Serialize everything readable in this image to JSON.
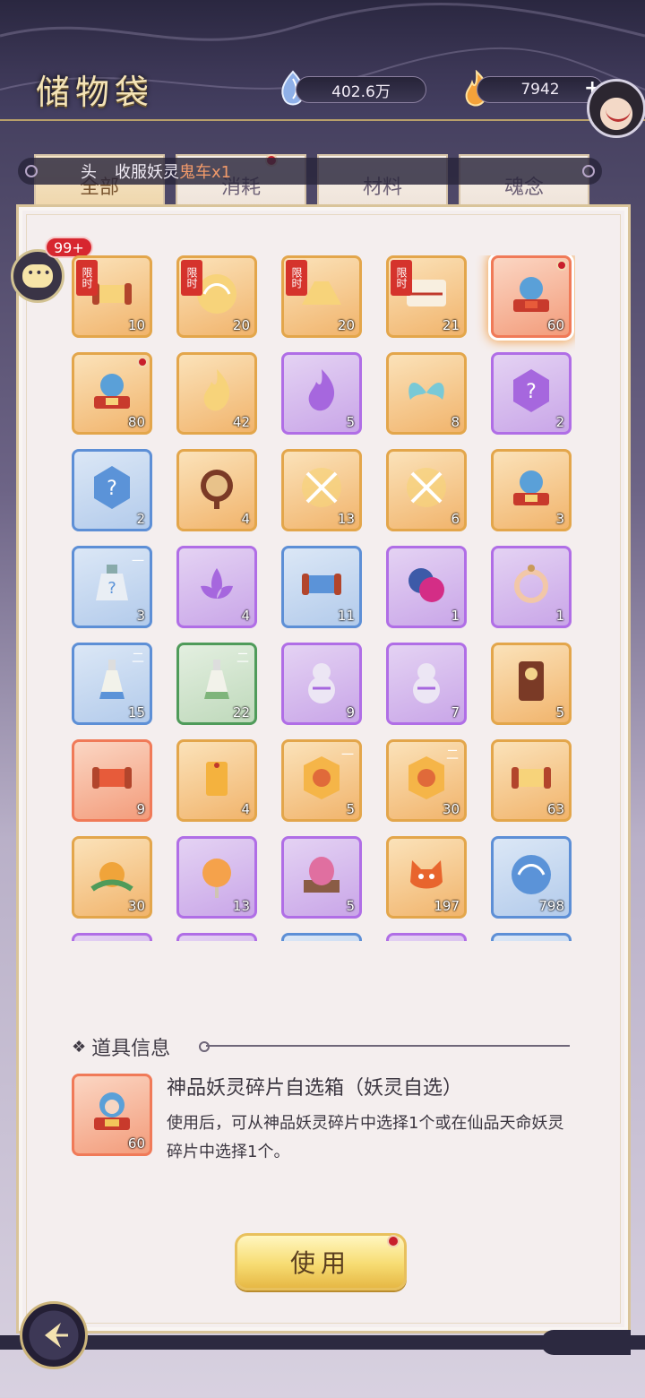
{
  "header": {
    "title": "储物袋",
    "currency_1": {
      "value": "402.6万",
      "icon": "spirit-gem-icon"
    },
    "currency_2": {
      "value": "7942",
      "icon": "flame-icon",
      "add": "+"
    }
  },
  "notice": {
    "prefix": "头",
    "text": "收服妖灵",
    "highlight": "鬼车x1"
  },
  "tabs": [
    {
      "label": "全部",
      "active": true
    },
    {
      "label": "消耗",
      "active": false
    },
    {
      "label": "材料",
      "active": false
    },
    {
      "label": "魂念",
      "active": false
    }
  ],
  "chat": {
    "badge": "99+"
  },
  "items": [
    {
      "count": "10",
      "rarity": "orange",
      "limit": "限时",
      "art": "scroll"
    },
    {
      "count": "20",
      "rarity": "orange",
      "limit": "限时",
      "art": "orb"
    },
    {
      "count": "20",
      "rarity": "orange",
      "limit": "限时",
      "art": "ingot"
    },
    {
      "count": "21",
      "rarity": "orange",
      "limit": "限时",
      "art": "sword-scroll"
    },
    {
      "count": "60",
      "rarity": "red",
      "dot": true,
      "selected": true,
      "art": "chest"
    },
    {
      "count": "80",
      "rarity": "orange",
      "dot": true,
      "art": "chest"
    },
    {
      "count": "42",
      "rarity": "orange",
      "art": "flame"
    },
    {
      "count": "5",
      "rarity": "purple",
      "art": "flame"
    },
    {
      "count": "8",
      "rarity": "orange",
      "art": "wings"
    },
    {
      "count": "2",
      "rarity": "purple",
      "art": "mystery"
    },
    {
      "count": "2",
      "rarity": "blue",
      "art": "mystery"
    },
    {
      "count": "4",
      "rarity": "orange",
      "art": "mirror"
    },
    {
      "count": "13",
      "rarity": "orange",
      "art": "swords"
    },
    {
      "count": "6",
      "rarity": "orange",
      "art": "swords"
    },
    {
      "count": "3",
      "rarity": "orange",
      "art": "chest"
    },
    {
      "count": "3",
      "rarity": "blue",
      "art": "bottle",
      "tier": "一"
    },
    {
      "count": "4",
      "rarity": "purple",
      "art": "lotus"
    },
    {
      "count": "11",
      "rarity": "blue",
      "art": "scroll"
    },
    {
      "count": "1",
      "rarity": "purple",
      "art": "disc"
    },
    {
      "count": "1",
      "rarity": "purple",
      "art": "ring"
    },
    {
      "count": "15",
      "rarity": "blue",
      "art": "vase",
      "tier": "二"
    },
    {
      "count": "22",
      "rarity": "green",
      "art": "vase",
      "tier": "二"
    },
    {
      "count": "9",
      "rarity": "purple",
      "art": "gourd"
    },
    {
      "count": "7",
      "rarity": "purple",
      "art": "gourd"
    },
    {
      "count": "5",
      "rarity": "orange",
      "art": "token"
    },
    {
      "count": "9",
      "rarity": "red",
      "art": "scroll"
    },
    {
      "count": "4",
      "rarity": "orange",
      "art": "tag"
    },
    {
      "count": "5",
      "rarity": "orange",
      "art": "badge",
      "tier": "一"
    },
    {
      "count": "30",
      "rarity": "orange",
      "art": "badge",
      "tier": "二"
    },
    {
      "count": "63",
      "rarity": "orange",
      "art": "scroll"
    },
    {
      "count": "30",
      "rarity": "orange",
      "art": "fruit"
    },
    {
      "count": "13",
      "rarity": "purple",
      "art": "talisman"
    },
    {
      "count": "5",
      "rarity": "purple",
      "art": "egg"
    },
    {
      "count": "197",
      "rarity": "orange",
      "art": "fox"
    },
    {
      "count": "798",
      "rarity": "blue",
      "art": "orb"
    }
  ],
  "info": {
    "header": "道具信息",
    "item_count": "60",
    "name": "神品妖灵碎片自选箱（妖灵自选）",
    "desc": "使用后，可从神品妖灵碎片中选择1个或在仙品天命妖灵碎片中选择1个。"
  },
  "use_button": "使用",
  "colors": {
    "accent": "#e3a64b",
    "header": "#3c3756",
    "panel": "#f4eeee"
  }
}
